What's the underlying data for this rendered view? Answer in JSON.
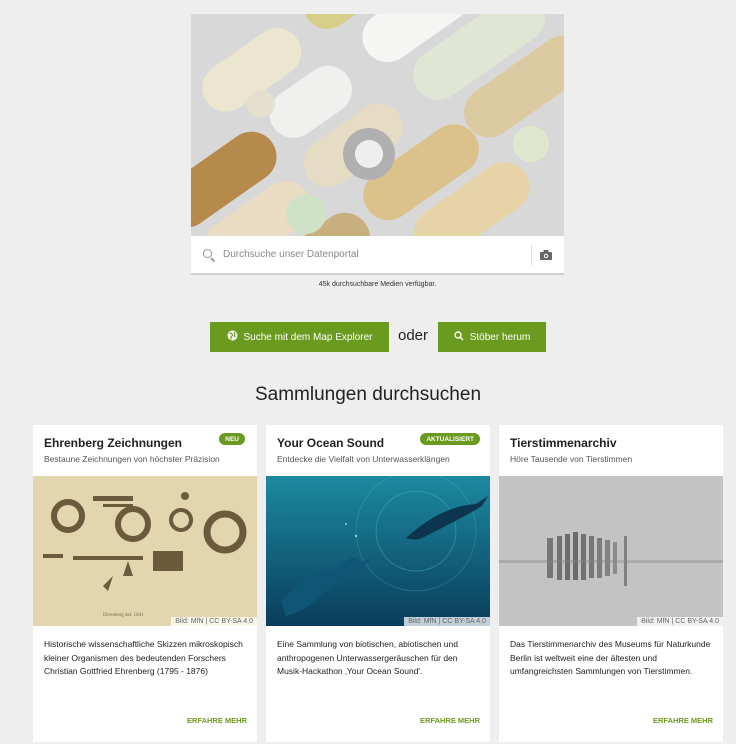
{
  "search": {
    "placeholder": "Durchsuche unser Datenportal",
    "media_count": "45k durchsuchbare Medien verfügbar."
  },
  "actions": {
    "map_explorer_label": "Suche mit dem Map Explorer",
    "or_label": "oder",
    "browse_label": "Stöber herum"
  },
  "section_title": "Sammlungen durchsuchen",
  "cards": [
    {
      "title": "Ehrenberg Zeichnungen",
      "subtitle": "Bestaune Zeichnungen von höchster Präzision",
      "badge": "NEU",
      "credit": "Bild: MfN | CC BY-SA 4.0",
      "description": "Historische wissenschaftliche Skizzen mikroskopisch kleiner Organismen des bedeutenden Forschers Christian Gottfried Ehrenberg (1795 - 1876)",
      "more": "ERFAHRE MEHR"
    },
    {
      "title": "Your Ocean Sound",
      "subtitle": "Entdecke die Vielfalt von Unterwasserklängen",
      "badge": "AKTUALISIERT",
      "credit": "Bild: MfN | CC BY-SA 4.0",
      "description": "Eine Sammlung von biotischen, abiotischen und anthropogenen Unterwassergeräuschen für den Musik-Hackathon ‚Your Ocean Sound'.",
      "more": "ERFAHRE MEHR"
    },
    {
      "title": "Tierstimmenarchiv",
      "subtitle": "Höre Tausende von Tierstimmen",
      "badge": "",
      "credit": "Bild: MfN | CC BY-SA 4.0",
      "description": "Das Tierstimmenarchiv des Museums für Naturkunde Berlin ist weltweit eine der ältesten und umfangreichsten Sammlungen von Tierstimmen.",
      "more": "ERFAHRE MEHR"
    }
  ],
  "colors": {
    "accent": "#6a9b1e",
    "background": "#eeeeee"
  },
  "icons": {
    "search": "search-icon",
    "camera": "camera-icon",
    "globe": "globe-icon"
  }
}
